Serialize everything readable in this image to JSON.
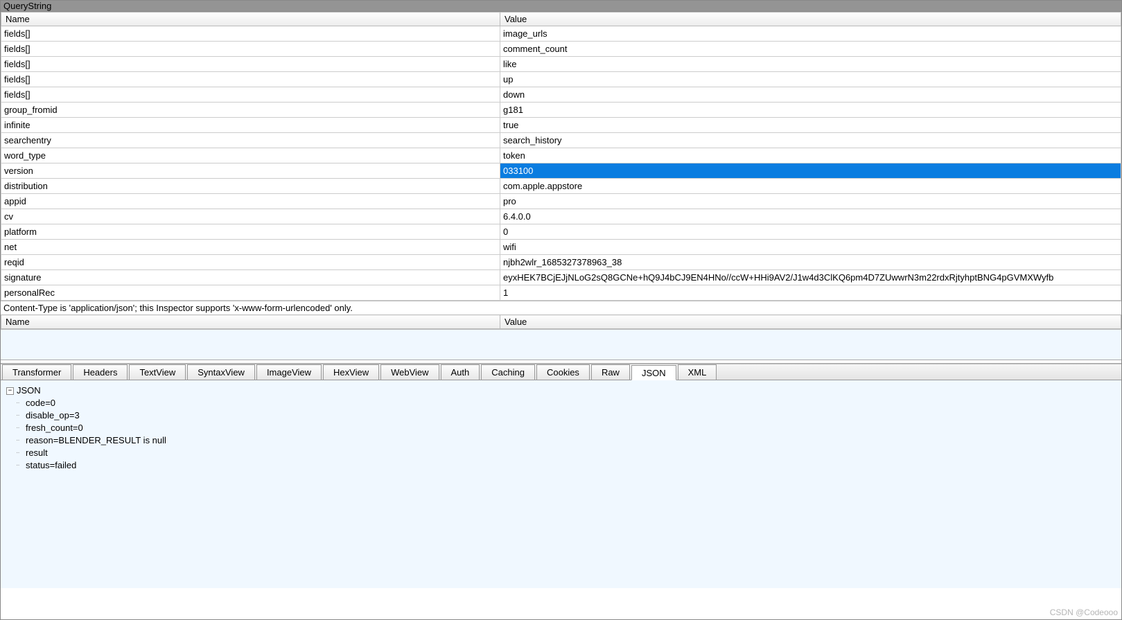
{
  "querystring": {
    "title": "QueryString",
    "headers": {
      "name": "Name",
      "value": "Value"
    },
    "rows": [
      {
        "name": "fields[]",
        "value": "image_urls",
        "selected": false
      },
      {
        "name": "fields[]",
        "value": "comment_count",
        "selected": false
      },
      {
        "name": "fields[]",
        "value": "like",
        "selected": false
      },
      {
        "name": "fields[]",
        "value": "up",
        "selected": false
      },
      {
        "name": "fields[]",
        "value": "down",
        "selected": false
      },
      {
        "name": "group_fromid",
        "value": "g181",
        "selected": false
      },
      {
        "name": "infinite",
        "value": "true",
        "selected": false
      },
      {
        "name": "searchentry",
        "value": "search_history",
        "selected": false
      },
      {
        "name": "word_type",
        "value": "token",
        "selected": false
      },
      {
        "name": "version",
        "value": "033100",
        "selected": true
      },
      {
        "name": "distribution",
        "value": "com.apple.appstore",
        "selected": false
      },
      {
        "name": "appid",
        "value": "pro",
        "selected": false
      },
      {
        "name": "cv",
        "value": "6.4.0.0",
        "selected": false
      },
      {
        "name": "platform",
        "value": "0",
        "selected": false
      },
      {
        "name": "net",
        "value": "wifi",
        "selected": false
      },
      {
        "name": "reqid",
        "value": "njbh2wlr_1685327378963_38",
        "selected": false
      },
      {
        "name": "signature",
        "value": "eyxHEK7BCjEJjNLoG2sQ8GCNe+hQ9J4bCJ9EN4HNo//ccW+HHi9AV2/J1w4d3ClKQ6pm4D7ZUwwrN3m22rdxRjtyhptBNG4pGVMXWyfb",
        "selected": false
      },
      {
        "name": "personalRec",
        "value": "1",
        "selected": false
      }
    ]
  },
  "body": {
    "info": "Content-Type is 'application/json'; this Inspector supports 'x-www-form-urlencoded' only.",
    "headers": {
      "name": "Name",
      "value": "Value"
    }
  },
  "tabs": [
    {
      "id": "transformer",
      "label": "Transformer",
      "active": false
    },
    {
      "id": "headers",
      "label": "Headers",
      "active": false
    },
    {
      "id": "textview",
      "label": "TextView",
      "active": false
    },
    {
      "id": "syntaxview",
      "label": "SyntaxView",
      "active": false
    },
    {
      "id": "imageview",
      "label": "ImageView",
      "active": false
    },
    {
      "id": "hexview",
      "label": "HexView",
      "active": false
    },
    {
      "id": "webview",
      "label": "WebView",
      "active": false
    },
    {
      "id": "auth",
      "label": "Auth",
      "active": false
    },
    {
      "id": "caching",
      "label": "Caching",
      "active": false
    },
    {
      "id": "cookies",
      "label": "Cookies",
      "active": false
    },
    {
      "id": "raw",
      "label": "Raw",
      "active": false
    },
    {
      "id": "json",
      "label": "JSON",
      "active": true
    },
    {
      "id": "xml",
      "label": "XML",
      "active": false
    }
  ],
  "json_tree": {
    "root": "JSON",
    "children": [
      "code=0",
      "disable_op=3",
      "fresh_count=0",
      "reason=BLENDER_RESULT is null",
      "result",
      "status=failed"
    ]
  },
  "watermark": "CSDN @Codeooo"
}
